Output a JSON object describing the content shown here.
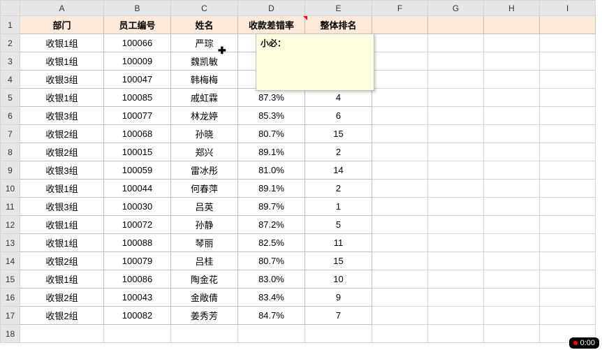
{
  "columns": [
    "A",
    "B",
    "C",
    "D",
    "E",
    "F",
    "G",
    "H",
    "I"
  ],
  "row_count": 18,
  "headers": {
    "A": "部门",
    "B": "员工编号",
    "C": "姓名",
    "D": "收款差错率",
    "E": "整体排名"
  },
  "rows": [
    {
      "dept": "收银1组",
      "id": "100066",
      "name": "严琮",
      "rate": "",
      "rank": ""
    },
    {
      "dept": "收银1组",
      "id": "100009",
      "name": "魏凯敏",
      "rate": "",
      "rank": ""
    },
    {
      "dept": "收银3组",
      "id": "100047",
      "name": "韩梅梅",
      "rate": "",
      "rank": ""
    },
    {
      "dept": "收银1组",
      "id": "100085",
      "name": "戚虹霖",
      "rate": "87.3%",
      "rank": "4"
    },
    {
      "dept": "收银3组",
      "id": "100077",
      "name": "林龙婷",
      "rate": "85.3%",
      "rank": "6"
    },
    {
      "dept": "收银2组",
      "id": "100068",
      "name": "孙晓",
      "rate": "80.7%",
      "rank": "15"
    },
    {
      "dept": "收银2组",
      "id": "100015",
      "name": "郑兴",
      "rate": "89.1%",
      "rank": "2"
    },
    {
      "dept": "收银3组",
      "id": "100059",
      "name": "雷冰彤",
      "rate": "81.0%",
      "rank": "14"
    },
    {
      "dept": "收银1组",
      "id": "100044",
      "name": "何春萍",
      "rate": "89.1%",
      "rank": "2"
    },
    {
      "dept": "收银3组",
      "id": "100030",
      "name": "吕英",
      "rate": "89.7%",
      "rank": "1"
    },
    {
      "dept": "收银1组",
      "id": "100072",
      "name": "孙静",
      "rate": "87.2%",
      "rank": "5"
    },
    {
      "dept": "收银1组",
      "id": "100088",
      "name": "琴丽",
      "rate": "82.5%",
      "rank": "11"
    },
    {
      "dept": "收银2组",
      "id": "100079",
      "name": "吕桂",
      "rate": "80.7%",
      "rank": "15"
    },
    {
      "dept": "收银1组",
      "id": "100086",
      "name": "陶金花",
      "rate": "83.0%",
      "rank": "10"
    },
    {
      "dept": "收银2组",
      "id": "100043",
      "name": "金敞倩",
      "rate": "83.4%",
      "rank": "9"
    },
    {
      "dept": "收银2组",
      "id": "100082",
      "name": "姜秀芳",
      "rate": "84.7%",
      "rank": "7"
    }
  ],
  "comment": {
    "author": "小必：",
    "body": ""
  },
  "timer": "0:00",
  "chart_data": {
    "type": "table",
    "title": "",
    "columns": [
      "部门",
      "员工编号",
      "姓名",
      "收款差错率",
      "整体排名"
    ],
    "data": [
      [
        "收银1组",
        "100066",
        "严琮",
        null,
        null
      ],
      [
        "收银1组",
        "100009",
        "魏凯敏",
        null,
        null
      ],
      [
        "收银3组",
        "100047",
        "韩梅梅",
        null,
        null
      ],
      [
        "收银1组",
        "100085",
        "戚虹霖",
        0.873,
        4
      ],
      [
        "收银3组",
        "100077",
        "林龙婷",
        0.853,
        6
      ],
      [
        "收银2组",
        "100068",
        "孙晓",
        0.807,
        15
      ],
      [
        "收银2组",
        "100015",
        "郑兴",
        0.891,
        2
      ],
      [
        "收银3组",
        "100059",
        "雷冰彤",
        0.81,
        14
      ],
      [
        "收银1组",
        "100044",
        "何春萍",
        0.891,
        2
      ],
      [
        "收银3组",
        "100030",
        "吕英",
        0.897,
        1
      ],
      [
        "收银1组",
        "100072",
        "孙静",
        0.872,
        5
      ],
      [
        "收银1组",
        "100088",
        "琴丽",
        0.825,
        11
      ],
      [
        "收银2组",
        "100079",
        "吕桂",
        0.807,
        15
      ],
      [
        "收银1组",
        "100086",
        "陶金花",
        0.83,
        10
      ],
      [
        "收银2组",
        "100043",
        "金敞倩",
        0.834,
        9
      ],
      [
        "收银2组",
        "100082",
        "姜秀芳",
        0.847,
        7
      ]
    ]
  }
}
